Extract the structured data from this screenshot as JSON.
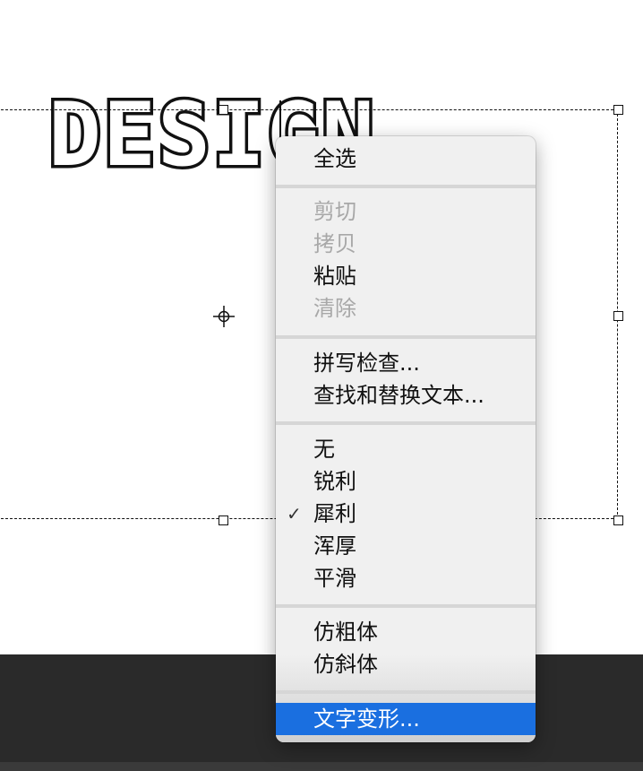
{
  "canvas": {
    "text_layer": "DESIGN"
  },
  "context_menu": {
    "items": [
      {
        "label": "全选",
        "enabled": true,
        "checked": false,
        "highlighted": false
      },
      {
        "label": "剪切",
        "enabled": false,
        "checked": false,
        "highlighted": false
      },
      {
        "label": "拷贝",
        "enabled": false,
        "checked": false,
        "highlighted": false
      },
      {
        "label": "粘贴",
        "enabled": true,
        "checked": false,
        "highlighted": false
      },
      {
        "label": "清除",
        "enabled": false,
        "checked": false,
        "highlighted": false
      },
      {
        "label": "拼写检查...",
        "enabled": true,
        "checked": false,
        "highlighted": false
      },
      {
        "label": "查找和替换文本...",
        "enabled": true,
        "checked": false,
        "highlighted": false
      },
      {
        "label": "无",
        "enabled": true,
        "checked": false,
        "highlighted": false
      },
      {
        "label": "锐利",
        "enabled": true,
        "checked": false,
        "highlighted": false
      },
      {
        "label": "犀利",
        "enabled": true,
        "checked": true,
        "highlighted": false
      },
      {
        "label": "浑厚",
        "enabled": true,
        "checked": false,
        "highlighted": false
      },
      {
        "label": "平滑",
        "enabled": true,
        "checked": false,
        "highlighted": false
      },
      {
        "label": "仿粗体",
        "enabled": true,
        "checked": false,
        "highlighted": false
      },
      {
        "label": "仿斜体",
        "enabled": true,
        "checked": false,
        "highlighted": false
      },
      {
        "label": "文字变形...",
        "enabled": true,
        "checked": false,
        "highlighted": true
      }
    ],
    "check_mark": "✓"
  },
  "colors": {
    "highlight": "#1a6fe0",
    "disabled_text": "#a8a8a8",
    "menu_bg": "#f0f0f0",
    "dark_panel": "#2a2a2a"
  }
}
